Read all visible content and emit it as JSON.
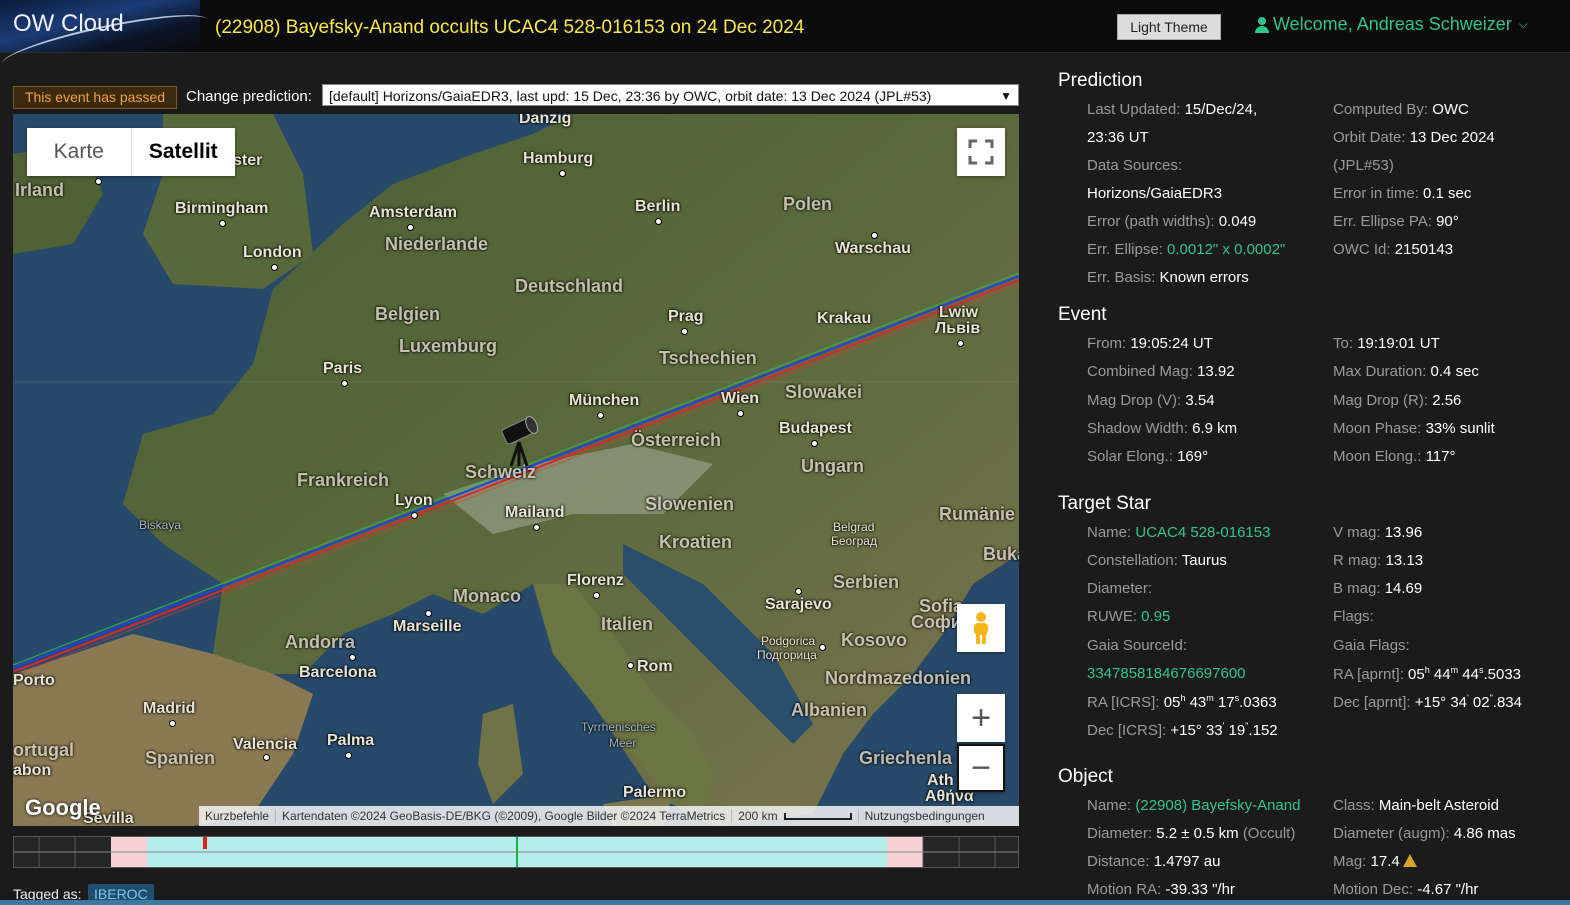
{
  "header": {
    "logo": "OW Cloud",
    "title": "(22908) Bayefsky-Anand occults UCAC4 528-016153 on 24 Dec 2024",
    "theme_button": "Light Theme",
    "welcome": "Welcome, Andreas Schweizer"
  },
  "topbar": {
    "status": "This event has passed",
    "change_label": "Change prediction:",
    "prediction_selected": "[default] Horizons/GaiaEDR3, last upd: 15 Dec, 23:36 by OWC, orbit date: 13 Dec 2024 (JPL#53)"
  },
  "map": {
    "type_karte": "Karte",
    "type_satellit": "Satellit",
    "google": "Google",
    "attribution": {
      "shortcuts": "Kurzbefehle",
      "data": "Kartendaten ©2024 GeoBasis-DE/BKG (©2009), Google Bilder ©2024 TerraMetrics",
      "scale": "200 km",
      "terms": "Nutzungsbedingungen"
    },
    "labels": {
      "danzig": "Danzig",
      "hamburg": "Hamburg",
      "irland": "Irland",
      "ster": "ster",
      "birmingham": "Birmingham",
      "amsterdam": "Amsterdam",
      "berlin": "Berlin",
      "polen": "Polen",
      "niederlande": "Niederlande",
      "london": "London",
      "warschau": "Warschau",
      "deutschland": "Deutschland",
      "belgien": "Belgien",
      "prag": "Prag",
      "krakau": "Krakau",
      "lwiw": "Lwiw",
      "lviv": "Львів",
      "luxemburg": "Luxemburg",
      "tschechien": "Tschechien",
      "paris": "Paris",
      "slowakei": "Slowakei",
      "muenchen": "München",
      "wien": "Wien",
      "budapest": "Budapest",
      "oesterreich": "Österreich",
      "schweiz": "Schweiz",
      "ungarn": "Ungarn",
      "frankreich": "Frankreich",
      "lyon": "Lyon",
      "mailand": "Mailand",
      "slowenien": "Slowenien",
      "biskaya": "Biskaya",
      "rumaenien": "Rumänie",
      "belgrad": "Belgrad",
      "beograd": "Београд",
      "kroatien": "Kroatien",
      "buka": "Buka",
      "florenz": "Florenz",
      "serbien": "Serbien",
      "monaco": "Monaco",
      "sarajevo": "Sarajevo",
      "sofia": "Sofia",
      "sofia_cyr": "Софи",
      "marseille": "Marseille",
      "italien": "Italien",
      "andorra": "Andorra",
      "podgorica": "Podgorica",
      "podgorica_cyr": "Подгорица",
      "kosovo": "Kosovo",
      "barcelona": "Barcelona",
      "rom": "Rom",
      "porto": "Porto",
      "nordmazedonien": "Nordmazedonien",
      "madrid": "Madrid",
      "albanien": "Albanien",
      "valencia": "Valencia",
      "palma": "Palma",
      "tyrrhenisches": "Tyrrhenisches",
      "meer": "Meer",
      "ortugal": "ortugal",
      "spanien": "Spanien",
      "griechenla": "Griechenla",
      "abon": "abon",
      "ath": "Ath",
      "athina": "Αθήνα",
      "sevilla": "Sevilla",
      "palermo": "Palermo"
    }
  },
  "timeline": {
    "playhead_color": "#e02020",
    "center_color": "#22aa44"
  },
  "tagged": {
    "label": "Tagged as:",
    "tag": "IBEROC"
  },
  "prediction": {
    "title": "Prediction",
    "last_updated_label": "Last Updated:",
    "last_updated_value": "15/Dec/24,",
    "last_updated_time": "23:36 UT",
    "computed_by_label": "Computed By:",
    "computed_by_value": "OWC",
    "orbit_date_label": "Orbit Date:",
    "orbit_date_value": "13 Dec 2024",
    "orbit_date_ref": "(JPL#53)",
    "data_sources_label": "Data Sources:",
    "data_sources_value": "Horizons/GaiaEDR3",
    "error_time_label": "Error in time:",
    "error_time_value": "0.1 sec",
    "error_path_label": "Error (path widths):",
    "error_path_value": "0.049",
    "err_pa_label": "Err. Ellipse PA:",
    "err_pa_value": "90°",
    "err_ellipse_label": "Err. Ellipse:",
    "err_ellipse_value": "0.0012\" x 0.0002\"",
    "owc_id_label": "OWC Id:",
    "owc_id_value": "2150143",
    "err_basis_label": "Err. Basis:",
    "err_basis_value": "Known errors"
  },
  "event": {
    "title": "Event",
    "from_label": "From:",
    "from_value": "19:05:24 UT",
    "to_label": "To:",
    "to_value": "19:19:01 UT",
    "combined_mag_label": "Combined Mag:",
    "combined_mag_value": "13.92",
    "max_duration_label": "Max Duration:",
    "max_duration_value": "0.4 sec",
    "mag_drop_v_label": "Mag Drop (V):",
    "mag_drop_v_value": "3.54",
    "mag_drop_r_label": "Mag Drop (R):",
    "mag_drop_r_value": "2.56",
    "shadow_width_label": "Shadow Width:",
    "shadow_width_value": "6.9 km",
    "moon_phase_label": "Moon Phase:",
    "moon_phase_value": "33% sunlit",
    "solar_elong_label": "Solar Elong.:",
    "solar_elong_value": "169°",
    "moon_elong_label": "Moon Elong.:",
    "moon_elong_value": "117°"
  },
  "target_star": {
    "title": "Target Star",
    "name_label": "Name:",
    "name_value": "UCAC4 528-016153",
    "vmag_label": "V mag:",
    "vmag_value": "13.96",
    "constellation_label": "Constellation:",
    "constellation_value": "Taurus",
    "rmag_label": "R mag:",
    "rmag_value": "13.13",
    "diameter_label": "Diameter:",
    "bmag_label": "B mag:",
    "bmag_value": "14.69",
    "ruwe_label": "RUWE:",
    "ruwe_value": "0.95",
    "flags_label": "Flags:",
    "gaia_source_label": "Gaia SourceId:",
    "gaia_flags_label": "Gaia Flags:",
    "gaia_source_value": "3347858184676697600",
    "ra_aprnt_label": "RA [aprnt]:",
    "ra_aprnt_h": "05",
    "ra_aprnt_m": "44",
    "ra_aprnt_s": "44",
    "ra_aprnt_frac": ".5033",
    "ra_icrs_label": "RA [ICRS]:",
    "ra_icrs_h": "05",
    "ra_icrs_m": "43",
    "ra_icrs_s": "17",
    "ra_icrs_frac": ".0363",
    "dec_aprnt_label": "Dec [aprnt]:",
    "dec_aprnt_deg": "+15° 34",
    "dec_aprnt_min": "02",
    "dec_aprnt_frac": ".834",
    "dec_icrs_label": "Dec [ICRS]:",
    "dec_icrs_deg": "+15° 33",
    "dec_icrs_min": "19",
    "dec_icrs_frac": ".152",
    "unit_h": "h",
    "unit_m": "m",
    "unit_s": "s",
    "unit_arcmin": "'",
    "unit_arcsec": "\""
  },
  "object": {
    "title": "Object",
    "name_label": "Name:",
    "name_value": "(22908) Bayefsky-Anand",
    "class_label": "Class:",
    "class_value": "Main-belt Asteroid",
    "diameter_label": "Diameter:",
    "diameter_value": "5.2 ± 0.5 km",
    "diameter_source": "(Occult)",
    "diameter_augm_label": "Diameter (augm):",
    "diameter_augm_value": "4.86 mas",
    "distance_label": "Distance:",
    "distance_value": "1.4797 au",
    "mag_label": "Mag:",
    "mag_value": "17.4",
    "motion_ra_label": "Motion RA:",
    "motion_ra_value": "-39.33 \"/hr",
    "motion_dec_label": "Motion Dec:",
    "motion_dec_value": "-4.67 \"/hr"
  }
}
